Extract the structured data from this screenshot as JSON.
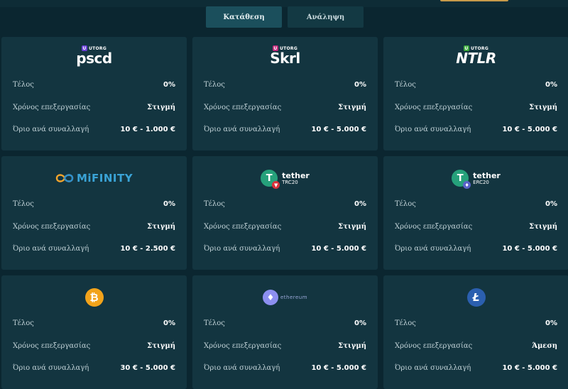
{
  "tabs": [
    {
      "label": "Κατάθεση",
      "active": true
    },
    {
      "label": "Ανάληψη",
      "active": false
    }
  ],
  "colors": {
    "background": "#0b2630",
    "card": "#133540",
    "tab_active": "#1b4f5c",
    "tether_green": "#26a17b",
    "bitcoin_orange": "#f2a31b",
    "litecoin_blue": "#2b5faf",
    "mifinity_blue": "#3aa3d6",
    "ethereum_purple": "#8c8ff0"
  },
  "cards": [
    {
      "logo": {
        "tag": "UTORG",
        "name": "pscd",
        "icon": "utorg-pscd-logo"
      },
      "fee_label": "Τέλος",
      "fee": "0%",
      "time_label": "Χρόνος επεξεργασίας",
      "time": "Στιγμή",
      "limit_label": "Όριο ανά συναλλαγή",
      "limit": "10 € - 1.000 €"
    },
    {
      "logo": {
        "tag": "UTORG",
        "name": "Skrl",
        "icon": "utorg-skrl-logo"
      },
      "fee_label": "Τέλος",
      "fee": "0%",
      "time_label": "Χρόνος επεξεργασίας",
      "time": "Στιγμή",
      "limit_label": "Όριο ανά συναλλαγή",
      "limit": "10 € - 5.000 €"
    },
    {
      "logo": {
        "tag": "UTORG",
        "name": "NTLR",
        "icon": "utorg-ntlr-logo"
      },
      "fee_label": "Τέλος",
      "fee": "0%",
      "time_label": "Χρόνος επεξεργασίας",
      "time": "Στιγμή",
      "limit_label": "Όριο ανά συναλλαγή",
      "limit": "10 € - 5.000 €"
    },
    {
      "logo": {
        "name": "MiFINITY",
        "icon": "mifinity-logo"
      },
      "fee_label": "Τέλος",
      "fee": "0%",
      "time_label": "Χρόνος επεξεργασίας",
      "time": "Στιγμή",
      "limit_label": "Όριο ανά συναλλαγή",
      "limit": "10 € - 2.500 €"
    },
    {
      "logo": {
        "name": "tether",
        "network": "TRC20",
        "icon": "tether-trc20-logo"
      },
      "fee_label": "Τέλος",
      "fee": "0%",
      "time_label": "Χρόνος επεξεργασίας",
      "time": "Στιγμή",
      "limit_label": "Όριο ανά συναλλαγή",
      "limit": "10 € - 5.000 €"
    },
    {
      "logo": {
        "name": "tether",
        "network": "ERC20",
        "icon": "tether-erc20-logo"
      },
      "fee_label": "Τέλος",
      "fee": "0%",
      "time_label": "Χρόνος επεξεργασίας",
      "time": "Στιγμή",
      "limit_label": "Όριο ανά συναλλαγή",
      "limit": "10 € - 5.000 €"
    },
    {
      "logo": {
        "icon": "bitcoin-icon"
      },
      "fee_label": "Τέλος",
      "fee": "0%",
      "time_label": "Χρόνος επεξεργασίας",
      "time": "Στιγμή",
      "limit_label": "Όριο ανά συναλλαγή",
      "limit": "30 € - 5.000 €"
    },
    {
      "logo": {
        "name": "ethereum",
        "icon": "ethereum-icon"
      },
      "fee_label": "Τέλος",
      "fee": "0%",
      "time_label": "Χρόνος επεξεργασίας",
      "time": "Στιγμή",
      "limit_label": "Όριο ανά συναλλαγή",
      "limit": "10 € - 5.000 €"
    },
    {
      "logo": {
        "icon": "litecoin-icon"
      },
      "fee_label": "Τέλος",
      "fee": "0%",
      "time_label": "Χρόνος επεξεργασίας",
      "time": "Άμεση",
      "limit_label": "Όριο ανά συναλλαγή",
      "limit": "10 € - 5.000 €"
    }
  ]
}
